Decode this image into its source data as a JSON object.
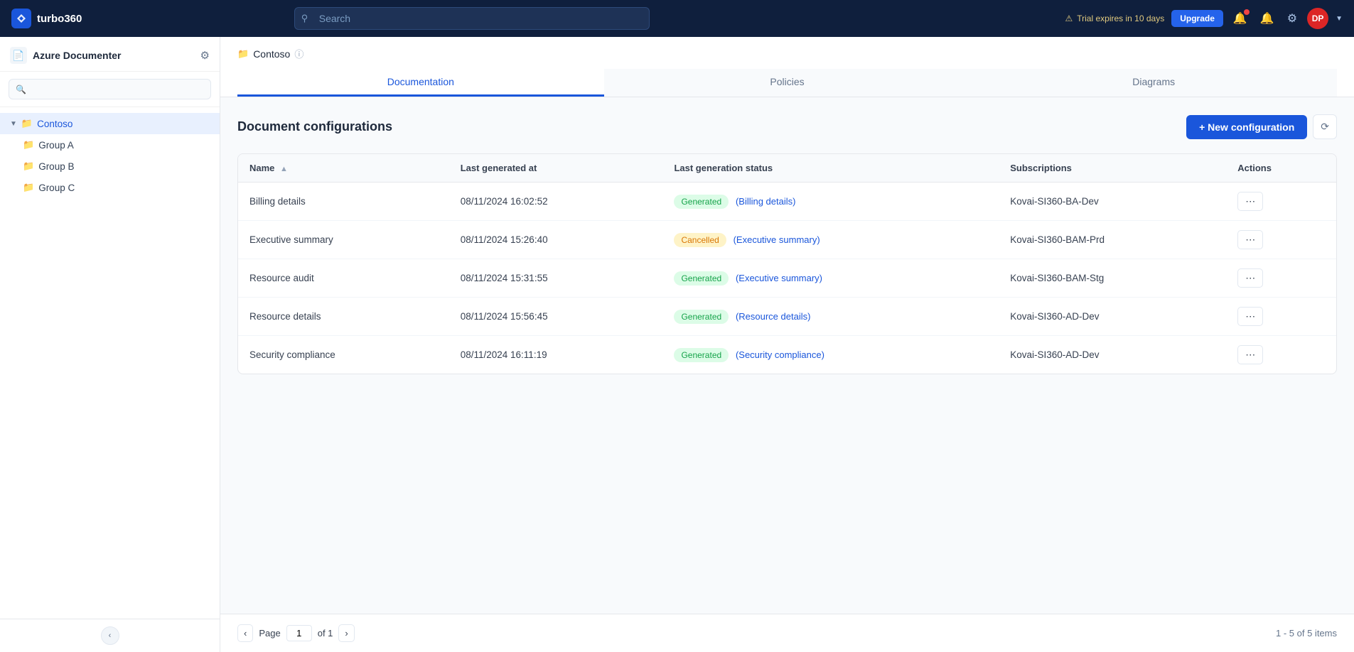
{
  "app": {
    "name": "turbo360",
    "logo_text": "turbo360"
  },
  "topnav": {
    "search_placeholder": "Search",
    "trial_text": "Trial expires in 10 days",
    "upgrade_label": "Upgrade",
    "avatar_initials": "DP"
  },
  "sidebar": {
    "app_name": "Azure Documenter",
    "search_placeholder": "",
    "tree": [
      {
        "label": "Contoso",
        "level": 0,
        "active": true,
        "expanded": true
      },
      {
        "label": "Group A",
        "level": 1,
        "active": false
      },
      {
        "label": "Group B",
        "level": 1,
        "active": false
      },
      {
        "label": "Group C",
        "level": 1,
        "active": false
      }
    ]
  },
  "breadcrumb": {
    "folder_label": "Contoso"
  },
  "tabs": [
    {
      "label": "Documentation",
      "active": true
    },
    {
      "label": "Policies",
      "active": false
    },
    {
      "label": "Diagrams",
      "active": false
    }
  ],
  "main": {
    "section_title": "Document configurations",
    "new_config_label": "+ New configuration",
    "refresh_tooltip": "Refresh",
    "table": {
      "columns": [
        "Name",
        "Last generated at",
        "Last generation status",
        "Subscriptions",
        "Actions"
      ],
      "rows": [
        {
          "name": "Billing details",
          "last_generated": "08/11/2024 16:02:52",
          "status": "Generated",
          "status_type": "generated",
          "status_link": "(Billing details)",
          "subscriptions": "Kovai-SI360-BA-Dev"
        },
        {
          "name": "Executive summary",
          "last_generated": "08/11/2024 15:26:40",
          "status": "Cancelled",
          "status_type": "cancelled",
          "status_link": "(Executive summary)",
          "subscriptions": "Kovai-SI360-BAM-Prd"
        },
        {
          "name": "Resource audit",
          "last_generated": "08/11/2024 15:31:55",
          "status": "Generated",
          "status_type": "generated",
          "status_link": "(Executive summary)",
          "subscriptions": "Kovai-SI360-BAM-Stg"
        },
        {
          "name": "Resource details",
          "last_generated": "08/11/2024 15:56:45",
          "status": "Generated",
          "status_type": "generated",
          "status_link": "(Resource details)",
          "subscriptions": "Kovai-SI360-AD-Dev"
        },
        {
          "name": "Security compliance",
          "last_generated": "08/11/2024 16:11:19",
          "status": "Generated",
          "status_type": "generated",
          "status_link": "(Security compliance)",
          "subscriptions": "Kovai-SI360-AD-Dev"
        }
      ]
    },
    "pagination": {
      "page_label": "Page",
      "current_page": "1",
      "of_label": "of 1",
      "items_summary": "1 - 5 of 5 items"
    }
  }
}
